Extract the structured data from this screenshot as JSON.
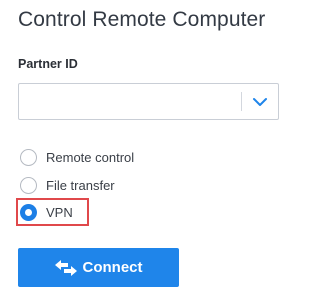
{
  "panel": {
    "title": "Control Remote Computer"
  },
  "partner_id": {
    "label": "Partner ID",
    "value": "",
    "placeholder": ""
  },
  "connection_mode": {
    "options": [
      {
        "label": "Remote control",
        "checked": false
      },
      {
        "label": "File transfer",
        "checked": false
      },
      {
        "label": "VPN",
        "checked": true
      }
    ]
  },
  "connect_button": {
    "label": "Connect",
    "icon": "swap-arrows-icon"
  },
  "colors": {
    "accent": "#1f85ea",
    "highlight_box": "#e0484b",
    "title_text": "#333a44"
  }
}
